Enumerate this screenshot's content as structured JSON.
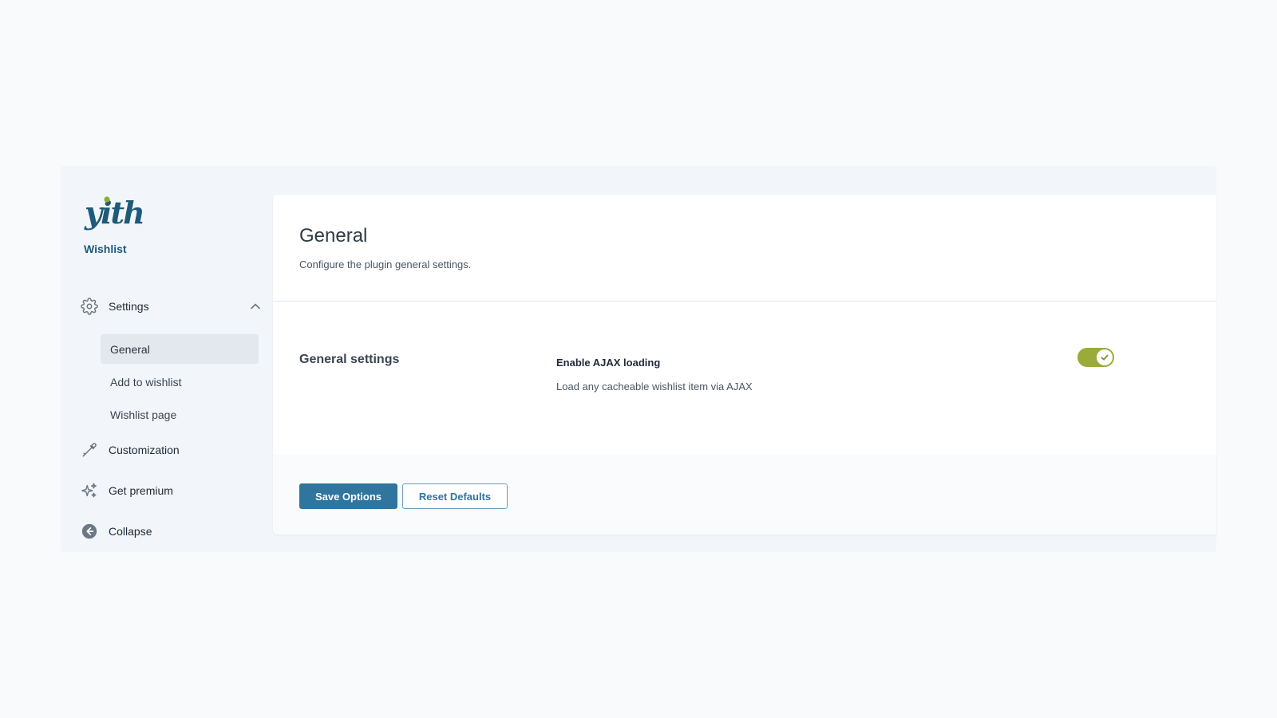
{
  "brand": {
    "logo_text": "yith",
    "product": "Wishlist"
  },
  "sidebar": {
    "settings": {
      "label": "Settings",
      "expanded": true,
      "children": [
        {
          "label": "General",
          "active": true
        },
        {
          "label": "Add to wishlist",
          "active": false
        },
        {
          "label": "Wishlist page",
          "active": false
        }
      ]
    },
    "customization": {
      "label": "Customization"
    },
    "premium": {
      "label": "Get premium"
    },
    "collapse": {
      "label": "Collapse"
    }
  },
  "page": {
    "title": "General",
    "subtitle": "Configure the plugin general settings."
  },
  "section": {
    "title": "General settings",
    "option": {
      "label": "Enable AJAX loading",
      "description": "Load any cacheable wishlist item via AJAX",
      "enabled": true
    }
  },
  "footer": {
    "save_label": "Save Options",
    "reset_label": "Reset Defaults"
  },
  "colors": {
    "brand": "#1f5a79",
    "primary": "#2f759d",
    "toggle_on": "#9aab3a",
    "logo_dot": "#8fae2e"
  }
}
